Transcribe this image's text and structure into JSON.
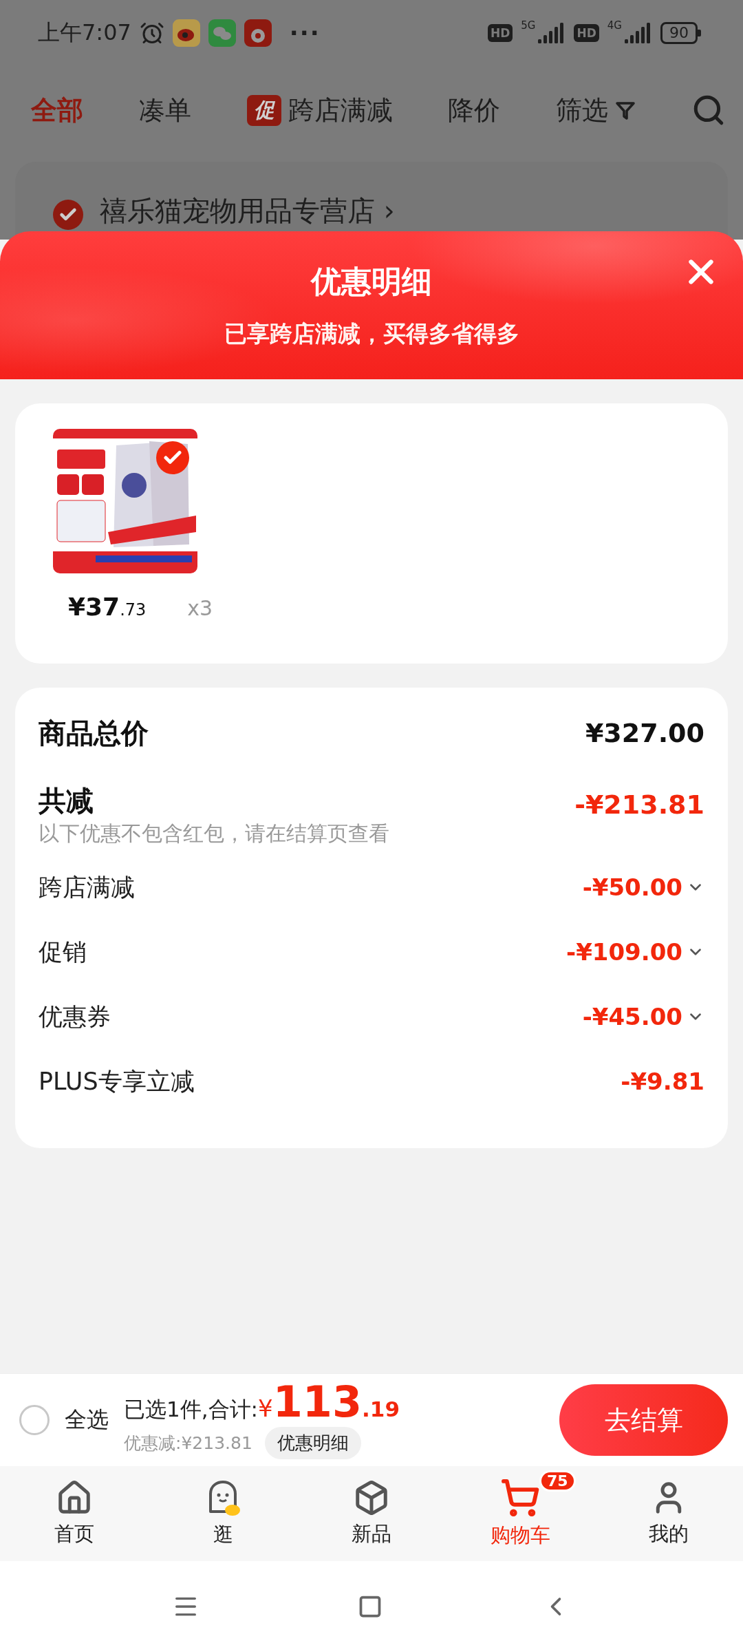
{
  "status_bar": {
    "time": "上午7:07",
    "more": "···",
    "networks": [
      {
        "badge": "HD",
        "type": "5G"
      },
      {
        "badge": "HD",
        "type": "4G"
      }
    ],
    "battery": "90"
  },
  "filter_tabs": [
    {
      "label": "全部",
      "selected": true,
      "kind": "plain"
    },
    {
      "label": "凑单",
      "selected": false,
      "kind": "plain"
    },
    {
      "label": "跨店满减",
      "selected": false,
      "kind": "promo",
      "badge": "促"
    },
    {
      "label": "降价",
      "selected": false,
      "kind": "plain"
    },
    {
      "label": "筛选",
      "selected": false,
      "kind": "filter"
    }
  ],
  "store": {
    "name": "禧乐猫宠物用品专营店",
    "checked": true,
    "arrow": "›"
  },
  "sheet": {
    "title": "优惠明细",
    "subtitle": "已享跨店满减，买得多省得多",
    "product": {
      "kind": "picture",
      "checked": true,
      "price_main": "¥37",
      "price_decimal": ".73",
      "quantity": "x3"
    },
    "summary": {
      "total_label": "商品总价",
      "total_value": "¥327.00",
      "reduction_label": "共减",
      "reduction_value": "-¥213.81",
      "note": "以下优惠不包含红包，请在结算页查看",
      "items": [
        {
          "label": "跨店满减",
          "value": "-¥50.00",
          "expandable": true
        },
        {
          "label": "促销",
          "value": "-¥109.00",
          "expandable": true
        },
        {
          "label": "优惠券",
          "value": "-¥45.00",
          "expandable": true
        },
        {
          "label": "PLUS专享立减",
          "value": "-¥9.81",
          "expandable": false
        }
      ]
    }
  },
  "checkout_bar": {
    "select_all": {
      "label": "全选",
      "checked": false
    },
    "selected_text": "已选1件,合计:",
    "currency": "¥",
    "amount_main": "113",
    "amount_decimal": ".19",
    "discount_text": "优惠减:¥213.81",
    "detail_button": "优惠明细",
    "checkout_button": "去结算"
  },
  "bottom_nav": [
    {
      "label": "首页",
      "selected": false
    },
    {
      "label": "逛",
      "selected": false
    },
    {
      "label": "新品",
      "selected": false
    },
    {
      "label": "购物车",
      "selected": true,
      "badge": "75"
    },
    {
      "label": "我的",
      "selected": false
    }
  ]
}
